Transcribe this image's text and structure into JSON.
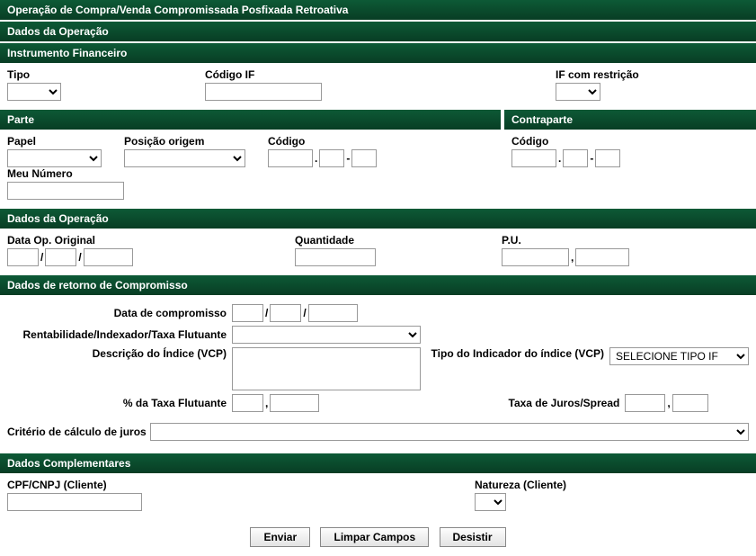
{
  "headers": {
    "main": "Operação de Compra/Venda Compromissada Posfixada Retroativa",
    "dados1": "Dados da Operação",
    "instrumento": "Instrumento Financeiro",
    "parte": "Parte",
    "contraparte": "Contraparte",
    "dados2": "Dados da Operação",
    "retorno": "Dados de retorno de Compromisso",
    "complementares": "Dados Complementares"
  },
  "instrumento": {
    "tipo_label": "Tipo",
    "codigo_if_label": "Código IF",
    "restricao_label": "IF com restrição"
  },
  "parte": {
    "papel_label": "Papel",
    "posicao_label": "Posição origem",
    "codigo_label": "Código",
    "meunumero_label": "Meu Número"
  },
  "contraparte": {
    "codigo_label": "Código"
  },
  "dados_op": {
    "data_original_label": "Data Op. Original",
    "quantidade_label": "Quantidade",
    "pu_label": "P.U."
  },
  "retorno": {
    "data_compromisso_label": "Data de compromisso",
    "rentabilidade_label": "Rentabilidade/Indexador/Taxa Flutuante",
    "descricao_label": "Descrição do Índice (VCP)",
    "tipo_indicador_label": "Tipo do Indicador do índice (VCP)",
    "tipo_indicador_option": "SELECIONE TIPO IF",
    "pct_taxa_label": "% da Taxa Flutuante",
    "taxa_juros_label": "Taxa de Juros/Spread",
    "criterio_label": "Critério de cálculo de juros"
  },
  "complementares": {
    "cpf_label": "CPF/CNPJ (Cliente)",
    "natureza_label": "Natureza (Cliente)"
  },
  "buttons": {
    "enviar": "Enviar",
    "limpar": "Limpar Campos",
    "desistir": "Desistir"
  }
}
